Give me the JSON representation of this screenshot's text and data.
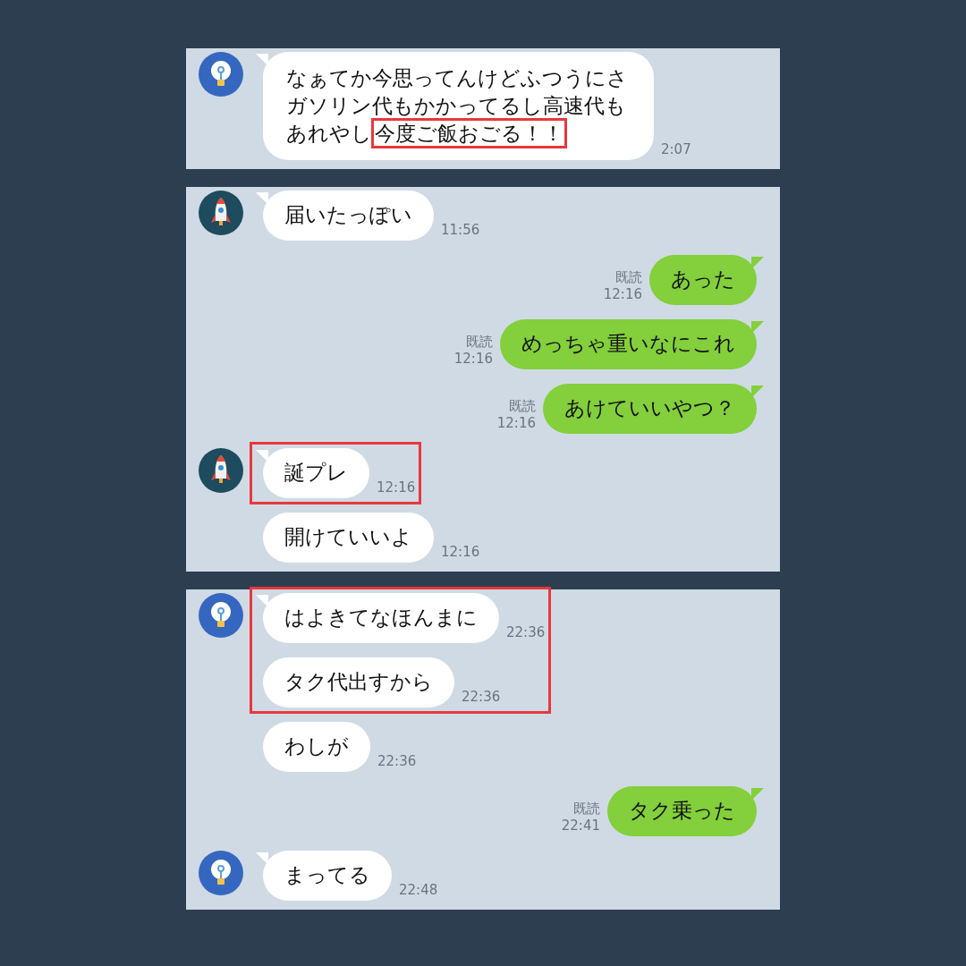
{
  "panels": [
    {
      "messages": [
        {
          "kind": "incoming",
          "avatar": {
            "kind": "lightbulb"
          },
          "highlighted": false,
          "segments": [
            {
              "text": "なぁてか今思ってんけどふつうにさガソリン代もかかってるし高速代もあれやし",
              "highlighted": false
            },
            {
              "text": "今度ご飯おごる！！",
              "highlighted": true
            }
          ],
          "time": "2:07"
        }
      ]
    },
    {
      "messages": [
        {
          "kind": "incoming",
          "avatar": {
            "kind": "rocket"
          },
          "highlighted": false,
          "text": "届いたっぽい",
          "time": "11:56"
        },
        {
          "kind": "outgoing",
          "read_label": "既読",
          "text": "あった",
          "time": "12:16"
        },
        {
          "kind": "outgoing",
          "read_label": "既読",
          "text": "めっちゃ重いなにこれ",
          "time": "12:16"
        },
        {
          "kind": "outgoing",
          "read_label": "既読",
          "text": "あけていいやつ？",
          "time": "12:16"
        },
        {
          "kind": "incoming",
          "avatar": {
            "kind": "rocket"
          },
          "highlighted": true,
          "text": "誕プレ",
          "time": "12:16"
        },
        {
          "kind": "incoming",
          "highlighted": false,
          "text": "開けていいよ",
          "time": "12:16"
        }
      ]
    },
    {
      "messages": [
        {
          "kind": "incoming",
          "avatar": {
            "kind": "lightbulb"
          },
          "highlighted": true,
          "text": "はよきてなほんまに",
          "time": "22:36"
        },
        {
          "kind": "incoming",
          "highlighted": true,
          "text": "タク代出すから",
          "time": "22:36"
        },
        {
          "kind": "incoming",
          "highlighted": false,
          "text": "わしが",
          "time": "22:36"
        },
        {
          "kind": "outgoing",
          "read_label": "既読",
          "text": "タク乗った",
          "time": "22:41"
        },
        {
          "kind": "incoming",
          "avatar": {
            "kind": "lightbulb"
          },
          "highlighted": false,
          "text": "まってる",
          "time": "22:48"
        }
      ]
    }
  ]
}
